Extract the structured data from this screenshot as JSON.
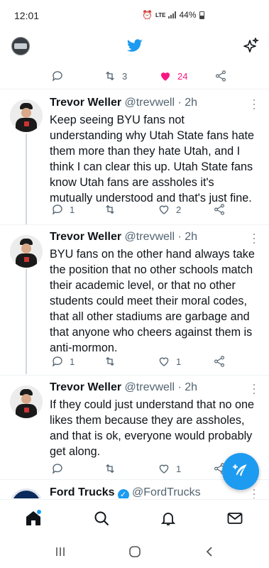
{
  "status_bar": {
    "time": "12:01",
    "network": "LTE",
    "battery": "44%"
  },
  "top_bar": {
    "logo_icon": "twitter-bird-icon",
    "feature_icon": "sparkle-icon"
  },
  "top_actions": {
    "retweets": "3",
    "likes": "24"
  },
  "tweets": [
    {
      "name": "Trevor Weller",
      "handle": "@trevwell",
      "time": "· 2h",
      "text": "Keep seeing BYU fans not understanding why Utah State fans hate them more than they hate Utah, and I think I can clear this up. Utah State fans know Utah fans are assholes it's mutually understood and that's just fine.",
      "replies": "1",
      "retweets": "",
      "likes": "2"
    },
    {
      "name": "Trevor Weller",
      "handle": "@trevwell",
      "time": "· 2h",
      "text": "BYU fans on the other hand always take the position that no other schools match their academic level, or that no other students could meet their moral codes, that all other stadiums are garbage and that anyone who cheers against them is anti-mormon.",
      "replies": "1",
      "retweets": "",
      "likes": "1"
    },
    {
      "name": "Trevor Weller",
      "handle": "@trevwell",
      "time": "· 2h",
      "text": "If they could just understand that no one likes them because they are assholes, and that is ok, everyone would probably get along.",
      "replies": "",
      "retweets": "",
      "likes": "1"
    }
  ],
  "next_tweet": {
    "name": "Ford Trucks",
    "handle": "@FordTrucks"
  },
  "bottom_nav": [
    "home-icon",
    "search-icon",
    "notifications-icon",
    "messages-icon"
  ],
  "colors": {
    "accent": "#1d9bf0",
    "like": "#f91880",
    "text": "#0f1419",
    "muted": "#536471"
  }
}
